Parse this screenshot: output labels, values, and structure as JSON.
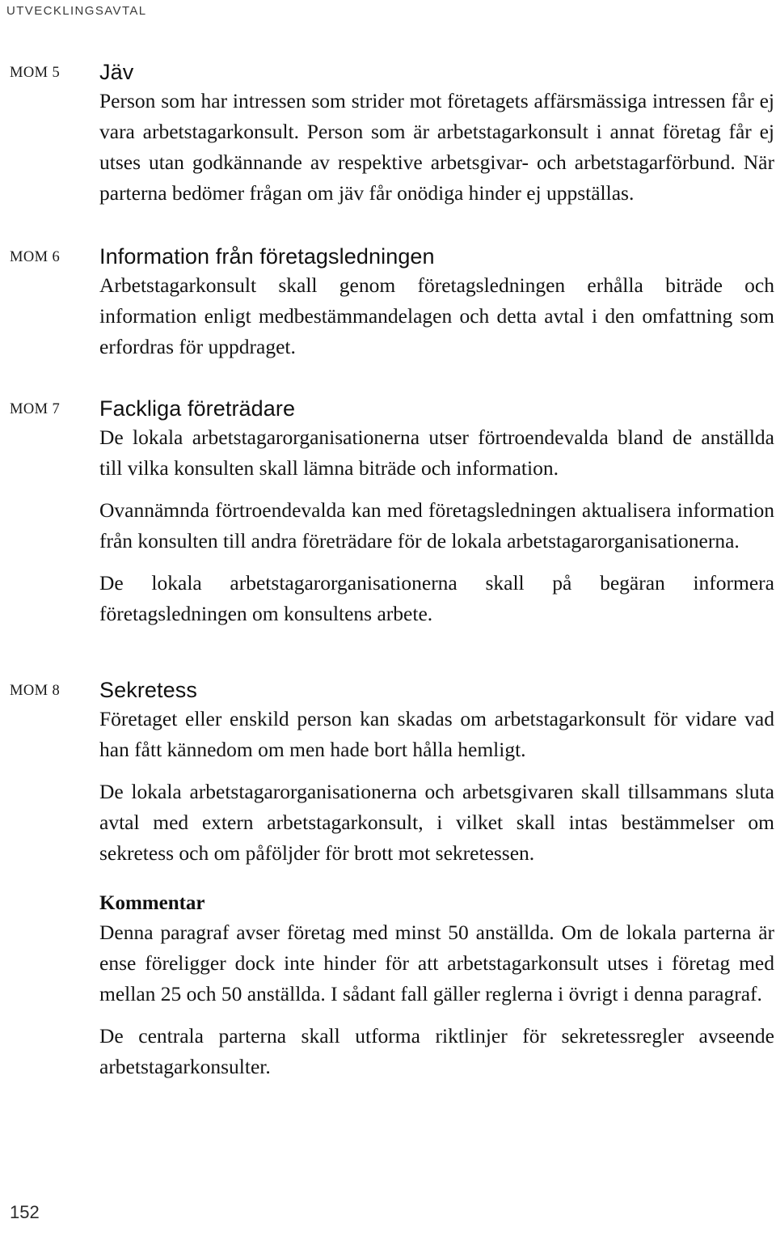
{
  "header": {
    "running_title": "UTVECKLINGSAVTAL"
  },
  "folio": {
    "page_number": "152"
  },
  "sections": [
    {
      "label": "MOM 5",
      "heading": "Jäv",
      "paragraphs": [
        "Person som har intressen som strider mot företagets affärsmässiga intressen får ej vara arbetstagarkonsult. Person som är arbetstagarkonsult i annat företag får ej utses utan godkännande av respektive arbetsgivar- och arbetstagarförbund. När parterna bedömer frågan om jäv får onödiga hinder ej uppställas."
      ]
    },
    {
      "label": "MOM 6",
      "heading": "Information från företagsledningen",
      "paragraphs": [
        "Arbetstagarkonsult skall genom företagsledningen erhålla biträde och information enligt medbestämmandelagen och detta avtal i den omfattning som erfordras för uppdraget."
      ]
    },
    {
      "label": "MOM 7",
      "heading": "Fackliga företrädare",
      "paragraphs": [
        "De lokala arbetstagarorganisationerna utser förtroendevalda bland de anställda till vilka konsulten skall lämna biträde och information.",
        "Ovannämnda förtroendevalda kan med företagsledningen aktualisera information från konsulten till andra företrädare för de lokala arbetstagarorganisationerna.",
        "De lokala arbetstagarorganisationerna skall på begäran informera företagsledningen om konsultens arbete."
      ]
    },
    {
      "label": "MOM 8",
      "heading": "Sekretess",
      "paragraphs": [
        "Företaget eller enskild person kan skadas om arbetstagarkonsult för vidare vad han fått kännedom om men hade bort hålla hemligt.",
        "De lokala arbetstagarorganisationerna och arbetsgivaren skall tillsammans sluta avtal med extern arbetstagarkonsult, i vilket skall intas bestämmelser om sekretess och om påföljder för brott mot sekretessen."
      ],
      "comment": {
        "subheading": "Kommentar",
        "paragraphs": [
          "Denna paragraf avser företag med minst 50 anställda. Om de lokala parterna är ense föreligger dock inte hinder för att arbetstagarkonsult utses i företag med mellan 25 och 50 anställda. I sådant fall gäller reglerna i övrigt i denna paragraf.",
          "De centrala parterna skall utforma riktlinjer för sekretessregler avseende arbetstagarkonsulter."
        ]
      }
    }
  ]
}
